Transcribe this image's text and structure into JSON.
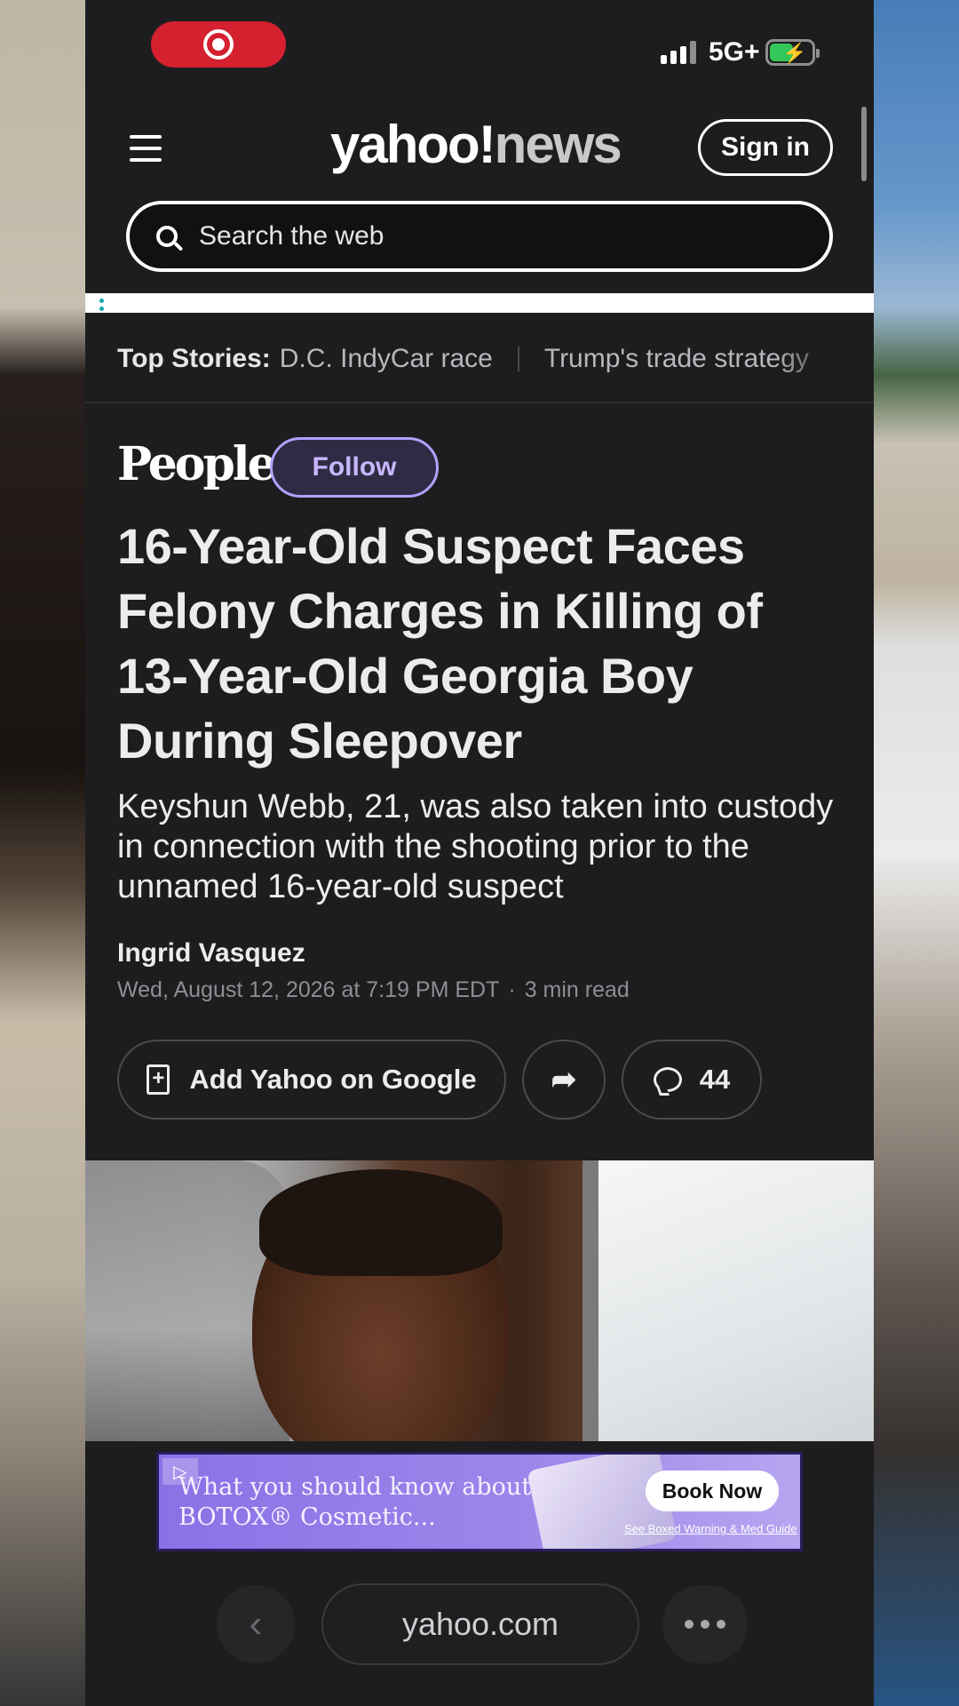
{
  "status": {
    "network": "5G+"
  },
  "header": {
    "logo_main": "yahoo!",
    "logo_sub": "news",
    "signin_label": "Sign in",
    "search_placeholder": "Search the web"
  },
  "top_stories": {
    "label": "Top Stories:",
    "items": [
      "D.C. IndyCar race",
      "Trump's trade strategy"
    ]
  },
  "article": {
    "publisher": "People",
    "follow_label": "Follow",
    "headline": "16-Year-Old Suspect Faces Felony Charges in Killing of 13-Year-Old Georgia Boy During Sleepover",
    "subhead": "Keyshun Webb, 21, was also taken into custody in connection with the shooting prior to the unnamed 16-year-old suspect",
    "author": "Ingrid Vasquez",
    "date": "Wed, August 12, 2026 at 7:19 PM EDT",
    "read_time": "3 min read",
    "add_google_label": "Add Yahoo on Google",
    "comment_count": "44"
  },
  "ad": {
    "text_line1": "What you should know about",
    "text_line2": "BOTOX® Cosmetic...",
    "cta": "Book Now",
    "fine_print": "See Boxed Warning & Med Guide"
  },
  "browser": {
    "url": "yahoo.com"
  },
  "colors": {
    "background": "#1d1d1f",
    "record_pill": "#d4202f",
    "follow_accent": "#b4a0ff",
    "ad_purple": "#8a72e6",
    "battery_green": "#34c759"
  }
}
